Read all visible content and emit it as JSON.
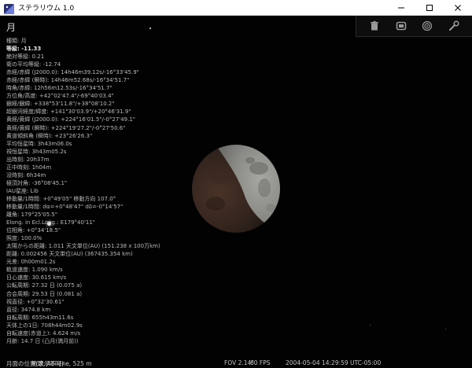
{
  "window": {
    "title": "ステラリウム 1.0",
    "minimize_icon": "minimize-icon",
    "maximize_icon": "maximize-icon",
    "close_icon": "close-icon"
  },
  "toolbar": {
    "items": [
      "trash-icon",
      "screen-icon",
      "deep-sky-icon",
      "wrench-icon"
    ]
  },
  "object": {
    "name": "月",
    "info": [
      "種類: 月",
      "等級: -11.33",
      "絶対等級: 0.21",
      "衛の平均等級: -12.74",
      "赤経/赤緯 (J2000.0): 14h46m39.12s/-16°33'45.9\"",
      "赤経/赤緯 (瞬時): 14h46m52.68s/-16°34'51.7\"",
      "時角/赤緯: 12h56m12.53s/-16°34'51.7\"",
      "方位角/高度: +42°02'47.4\"/-69°40'03.4\"",
      "銀経/銀緯: +338°53'11.8\"/+38°08'10.2\"",
      "超銀河経度/緯度: +141°30'03.9\"/+20°46'31.9\"",
      "黄経/黄緯 (J2000.0): +224°16'01.5\"/-0°27'49.1\"",
      "黄経/黄緯 (瞬時): +224°19'27.2\"/-0°27'50.6\"",
      "黄道傾斜角 (瞬時): +23°26'26.3\"",
      "平均恒星時: 3h43m06.0s",
      "視恒星時: 3h43m05.2s",
      "出時刻: 20h37m",
      "正中時刻: 1h04m",
      "没時刻: 6h34m",
      "極頂対角: -36°08'45.1\"",
      "IAU星座: Lib",
      "移動量/1時間: +0°49'05\" 移動方向 107.0°",
      "移動量/1時間: dα=+0°48'47\" dδ=-0°14'57\"",
      "離角: 179°25'05.5\"",
      "Elong. in Ecl.Long.: E179°40'11\"",
      "位相角: +0°34'18.5\"",
      "照度: 100.0%",
      "太陽からの距離: 1.011 天文単位(AU) (151.238 x 100万km)",
      "距離: 0.002456 天文単位(AU) (367435.354 km)",
      "光差: 0h00m01.2s",
      "軌道速度: 1.090 km/s",
      "日心速度: 30.615 km/s",
      "公転周期: 27.32 日 (0.075 a)",
      "合会周期: 29.53 日 (0.081 a)",
      "視直径: +0°32'30.61\"",
      "直径: 3474.8 km",
      "自転周期: 655h43m11.6s",
      "天体上の1日: 708h44m02.9s",
      "自転速度(赤道上): 4.624 m/s",
      "月齢: 14.7 日 (凸月(満月前))"
    ],
    "partial_line": "月面の位置(表示不可)"
  },
  "status": {
    "location": "地球, Abilene, 525 m",
    "fov": "FOV 2.14°",
    "fps": "60 FPS",
    "datetime": "2004-05-04 14:29:59 UTC-05:00"
  },
  "colors": {
    "sky": "#020203",
    "text": "#b9b9b9",
    "moon_lit": "#8e8e8a",
    "moon_shadow": "#3b2a22"
  }
}
